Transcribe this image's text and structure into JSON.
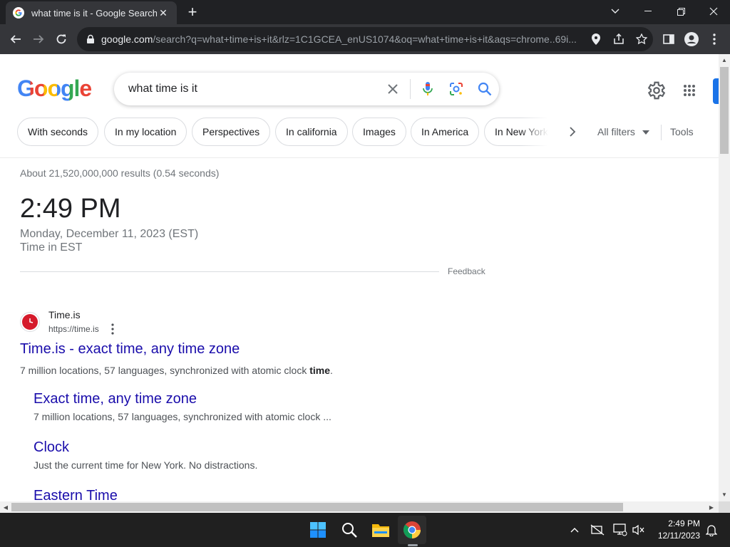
{
  "browser": {
    "tab_title": "what time is it - Google Search",
    "url_host": "google.com",
    "url_rest": "/search?q=what+time+is+it&rlz=1C1GCEA_enUS1074&oq=what+time+is+it&aqs=chrome..69i..."
  },
  "search": {
    "logo": "Google",
    "query": "what time is it"
  },
  "chips": [
    "With seconds",
    "In my location",
    "Perspectives",
    "In california",
    "Images",
    "In America",
    "In New York"
  ],
  "filters": {
    "all_filters": "All filters",
    "tools": "Tools"
  },
  "results": {
    "stats": "About 21,520,000,000 results (0.54 seconds)",
    "time_card": {
      "time": "2:49 PM",
      "date": "Monday, December 11, 2023 (EST)",
      "zone": "Time in EST",
      "feedback": "Feedback"
    },
    "first": {
      "site_name": "Time.is",
      "site_url": "https://time.is",
      "title": "Time.is - exact time, any time zone",
      "snippet_pre": "7 million locations, 57 languages, synchronized with atomic clock ",
      "snippet_bold": "time",
      "snippet_post": "."
    },
    "sitelinks": [
      {
        "title": "Exact time, any time zone",
        "snippet": "7 million locations, 57 languages, synchronized with atomic clock ..."
      },
      {
        "title": "Clock",
        "snippet": "Just the current time for New York. No distractions."
      },
      {
        "title": "Eastern Time",
        "snippet": ""
      }
    ]
  },
  "taskbar": {
    "time": "2:49 PM",
    "date": "12/11/2023"
  },
  "colors": {
    "link": "#1a0dab",
    "accent": "#1a73e8"
  }
}
